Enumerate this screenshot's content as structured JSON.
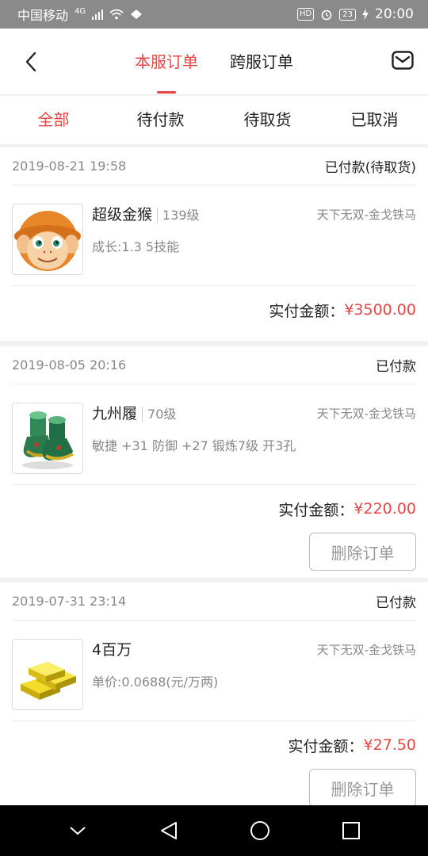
{
  "status_bar": {
    "carrier": "中国移动",
    "network": "4G",
    "hd": "HD",
    "battery": "23",
    "time": "20:00"
  },
  "header": {
    "tabs": [
      {
        "label": "本服订单",
        "active": true
      },
      {
        "label": "跨服订单",
        "active": false
      }
    ],
    "back_icon": "chevron-left-icon",
    "mail_icon": "mail-icon"
  },
  "filters": [
    {
      "label": "全部",
      "active": true
    },
    {
      "label": "待付款",
      "active": false
    },
    {
      "label": "待取货",
      "active": false
    },
    {
      "label": "已取消",
      "active": false
    }
  ],
  "orders": [
    {
      "time": "2019-08-21 19:58",
      "status": "已付款(待取货)",
      "item_name": "超级金猴",
      "item_level": "139级",
      "server": "天下无双-金戈铁马",
      "desc": "成长:1.3 5技能",
      "amount_label": "实付金额：",
      "amount": "¥3500.00",
      "thumb": "monkey-image"
    },
    {
      "time": "2019-08-05 20:16",
      "status": "已付款",
      "item_name": "九州履",
      "item_level": "70级",
      "server": "天下无双-金戈铁马",
      "desc": "敏捷 +31 防御 +27 锻炼7级 开3孔",
      "amount_label": "实付金额：",
      "amount": "¥220.00",
      "delete_label": "删除订单",
      "thumb": "boots-image"
    },
    {
      "time": "2019-07-31 23:14",
      "status": "已付款",
      "item_name": "4百万",
      "item_level": "",
      "server": "天下无双-金戈铁马",
      "desc": "单价:0.0688(元/万两)",
      "amount_label": "实付金额：",
      "amount": "¥27.50",
      "delete_label": "删除订单",
      "thumb": "gold-bars-image"
    }
  ],
  "colors": {
    "accent": "#e84545",
    "status_bar": "#8a8a8a",
    "nav_bar": "#000000"
  }
}
